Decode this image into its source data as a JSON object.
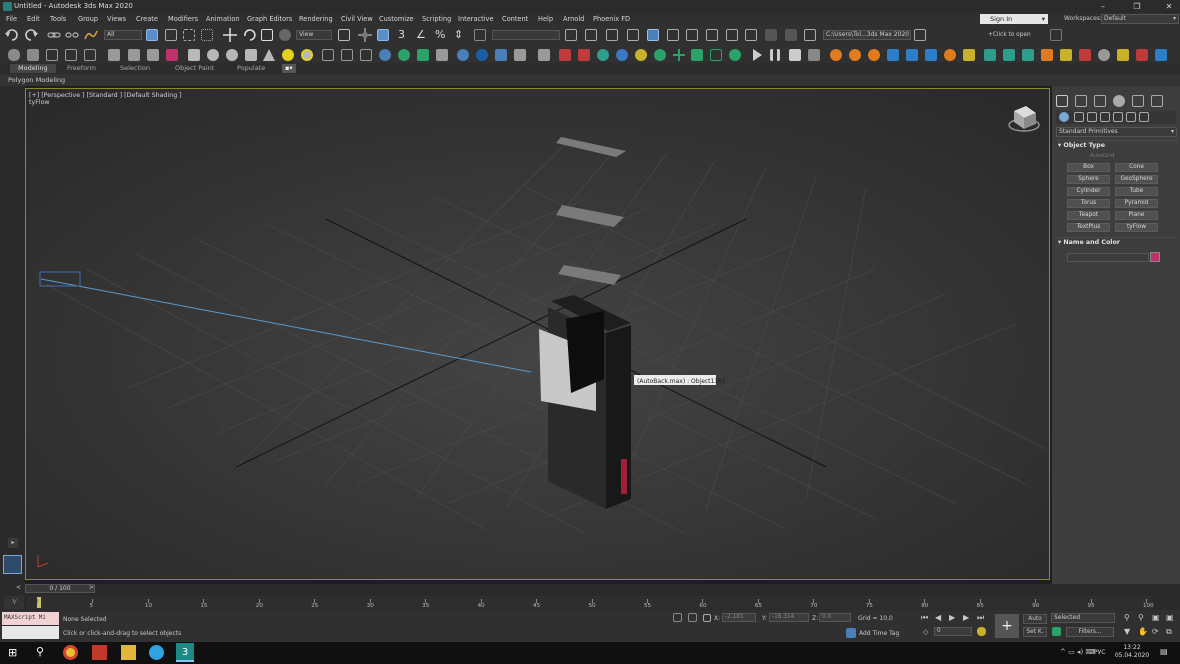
{
  "window": {
    "title": "Untitled - Autodesk 3ds Max 2020"
  },
  "menu": {
    "items": [
      "File",
      "Edit",
      "Tools",
      "Group",
      "Views",
      "Create",
      "Modifiers",
      "Animation",
      "Graph Editors",
      "Rendering",
      "Civil View",
      "Customize",
      "Scripting",
      "Interactive",
      "Content",
      "Help",
      "Arnold",
      "Phoenix FD"
    ],
    "sign_in": "Sign In",
    "workspaces_label": "Workspaces:",
    "workspace_value": "Default"
  },
  "toolbar": {
    "selection_filter": "All",
    "ref_coord": "View",
    "project_path": "C:\\Users\\Tol...3ds Max 2020",
    "click_to_open": "+Click to open"
  },
  "ribbon": {
    "tabs": [
      "Modeling",
      "Freeform",
      "Selection",
      "Object Paint",
      "Populate"
    ],
    "active_tab": "Modeling",
    "sub_panel": "Polygon Modeling"
  },
  "viewport": {
    "label": "[+] [Perspective ] [Standard ] [Default Shading ]",
    "sublabel": "tyFlow",
    "tooltip": "(AutoBack.max) : Object1392"
  },
  "command_panel": {
    "category": "Standard Primitives",
    "object_type_header": "Object Type",
    "autogrid": "AutoGrid",
    "buttons": [
      "Box",
      "Cone",
      "Sphere",
      "GeoSphere",
      "Cylinder",
      "Tube",
      "Torus",
      "Pyramid",
      "Teapot",
      "Plane",
      "TextPlus",
      "tyFlow"
    ],
    "name_color_header": "Name and Color",
    "object_color": "#c0306a"
  },
  "timeline": {
    "frame_display": "0 / 100",
    "ticks": [
      "0",
      "5",
      "10",
      "15",
      "20",
      "25",
      "30",
      "35",
      "40",
      "45",
      "50",
      "55",
      "60",
      "65",
      "70",
      "75",
      "80",
      "85",
      "90",
      "95",
      "100"
    ]
  },
  "status": {
    "maxscript": "MAXScript Mi",
    "selection": "None Selected",
    "prompt": "Click or click-and-drag to select objects",
    "x_label": "X:",
    "x_value": "-2.181",
    "y_label": "Y:",
    "y_value": "-16.314",
    "z_label": "Z:",
    "z_value": "0.0",
    "grid": "Grid = 10,0",
    "add_time_tag": "Add Time Tag",
    "auto": "Auto",
    "set_k": "Set K.",
    "selected": "Selected",
    "filters": "Filters...",
    "frame_value": "0"
  },
  "taskbar": {
    "time": "13:22",
    "date": "05.04.2020",
    "lang": "РУС"
  }
}
